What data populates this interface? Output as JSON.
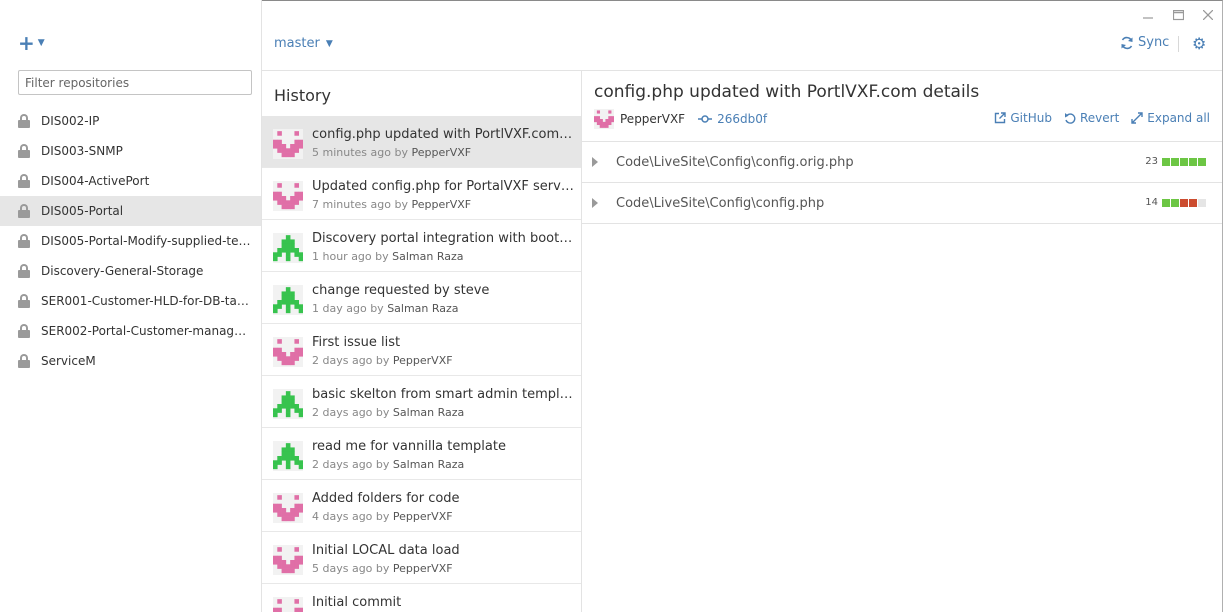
{
  "colors": {
    "accent": "#4a7fb5",
    "added": "#6cc644",
    "removed": "#cc4c2f",
    "neutral": "#e5e5e5",
    "avatar_pink": "#e06fa7",
    "avatar_green": "#37c34e"
  },
  "sidebar": {
    "add_icon": "plus-icon",
    "filter_placeholder": "Filter repositories",
    "repos": [
      {
        "label": "DIS002-IP"
      },
      {
        "label": "DIS003-SNMP"
      },
      {
        "label": "DIS004-ActivePort"
      },
      {
        "label": "DIS005-Portal"
      },
      {
        "label": "DIS005-Portal-Modify-supplied-templ..."
      },
      {
        "label": "Discovery-General-Storage"
      },
      {
        "label": "SER001-Customer-HLD-for-DB-tables"
      },
      {
        "label": "SER002-Portal-Customer-managemen..."
      },
      {
        "label": "ServiceM"
      }
    ],
    "active_repo_index": 3
  },
  "toolbar": {
    "branch": "master",
    "sync_label": "Sync",
    "window_controls": [
      "minimize",
      "maximize",
      "close"
    ]
  },
  "history": {
    "title": "History",
    "commits": [
      {
        "title": "config.php updated with PortlVXF.com d...",
        "time": "5 minutes ago",
        "by": "by",
        "author": "PepperVXF",
        "avatar": "pink"
      },
      {
        "title": "Updated config.php for PortalVXF server",
        "time": "7 minutes ago",
        "by": "by",
        "author": "PepperVXF",
        "avatar": "pink"
      },
      {
        "title": "Discovery portal integration with bootstr...",
        "time": "1 hour ago",
        "by": "by",
        "author": "Salman Raza",
        "avatar": "green"
      },
      {
        "title": "change requested by steve",
        "time": "1 day ago",
        "by": "by",
        "author": "Salman Raza",
        "avatar": "green"
      },
      {
        "title": "First issue list",
        "time": "2 days ago",
        "by": "by",
        "author": "PepperVXF",
        "avatar": "pink"
      },
      {
        "title": "basic skelton from smart admin templat...",
        "time": "2 days ago",
        "by": "by",
        "author": "Salman Raza",
        "avatar": "green"
      },
      {
        "title": "read me for vannilla template",
        "time": "2 days ago",
        "by": "by",
        "author": "Salman Raza",
        "avatar": "green"
      },
      {
        "title": "Added folders for code",
        "time": "4 days ago",
        "by": "by",
        "author": "PepperVXF",
        "avatar": "pink"
      },
      {
        "title": "Initial LOCAL data load",
        "time": "5 days ago",
        "by": "by",
        "author": "PepperVXF",
        "avatar": "pink"
      },
      {
        "title": "Initial commit",
        "time": "",
        "by": "",
        "author": "",
        "avatar": "pink"
      }
    ],
    "active_commit_index": 0
  },
  "detail": {
    "title": "config.php updated with PortlVXF.com details",
    "author": "PepperVXF",
    "sha": "266db0f",
    "actions": {
      "github": "GitHub",
      "revert": "Revert",
      "expand": "Expand all"
    },
    "files": [
      {
        "path": "Code\\LiveSite\\Config\\config.orig.php",
        "changes": "23",
        "blocks": [
          "added",
          "added",
          "added",
          "added",
          "added"
        ]
      },
      {
        "path": "Code\\LiveSite\\Config\\config.php",
        "changes": "14",
        "blocks": [
          "added",
          "added",
          "removed",
          "removed",
          "neutral"
        ]
      }
    ]
  }
}
